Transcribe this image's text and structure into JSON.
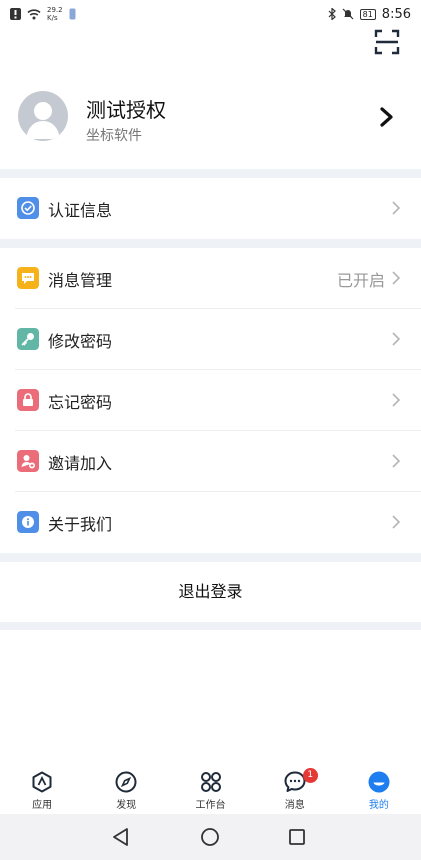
{
  "status_bar": {
    "net_speed_value": "29.2",
    "net_speed_unit": "K/s",
    "battery": "81",
    "time": "8:56"
  },
  "profile": {
    "name": "测试授权",
    "subtitle": "坐标软件"
  },
  "menu": {
    "certification": {
      "label": "认证信息",
      "color": "#4f8fe8"
    },
    "messages": {
      "label": "消息管理",
      "value": "已开启",
      "color": "#f5b21b"
    },
    "change_password": {
      "label": "修改密码",
      "color": "#61b6a6"
    },
    "forgot_password": {
      "label": "忘记密码",
      "color": "#ea6d79"
    },
    "invite": {
      "label": "邀请加入",
      "color": "#ea6d79"
    },
    "about": {
      "label": "关于我们",
      "color": "#4f8fe8"
    }
  },
  "logout_label": "退出登录",
  "bottom_nav": {
    "apps": "应用",
    "discover": "发现",
    "workbench": "工作台",
    "messages": "消息",
    "messages_badge": "1",
    "mine": "我的",
    "active_color": "#1e7ef0"
  }
}
